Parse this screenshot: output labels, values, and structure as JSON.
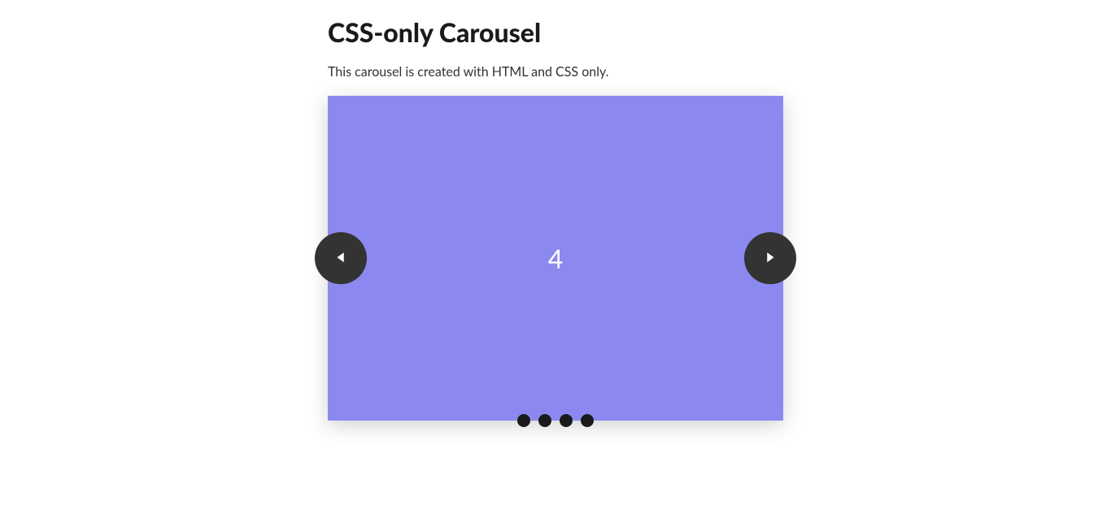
{
  "heading": "CSS-only Carousel",
  "description": "This carousel is created with HTML and CSS only.",
  "carousel": {
    "current_slide_label": "4",
    "slide_count": 4,
    "background_color": "#8b89f0"
  }
}
